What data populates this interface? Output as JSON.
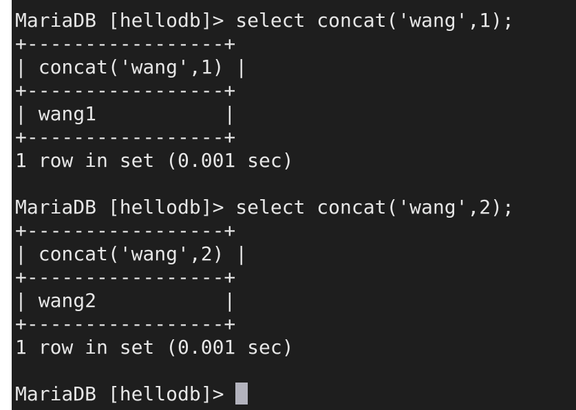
{
  "terminal": {
    "lines": [
      "MariaDB [hellodb]> select concat('wang',1);",
      "+-----------------+",
      "| concat('wang',1) |",
      "+-----------------+",
      "| wang1           |",
      "+-----------------+",
      "1 row in set (0.001 sec)",
      "",
      "MariaDB [hellodb]> select concat('wang',2);",
      "+-----------------+",
      "| concat('wang',2) |",
      "+-----------------+",
      "| wang2           |",
      "+-----------------+",
      "1 row in set (0.001 sec)",
      "",
      "MariaDB [hellodb]> "
    ],
    "cursor_color": "#b3b3bd",
    "background": "#1e1e1e"
  }
}
